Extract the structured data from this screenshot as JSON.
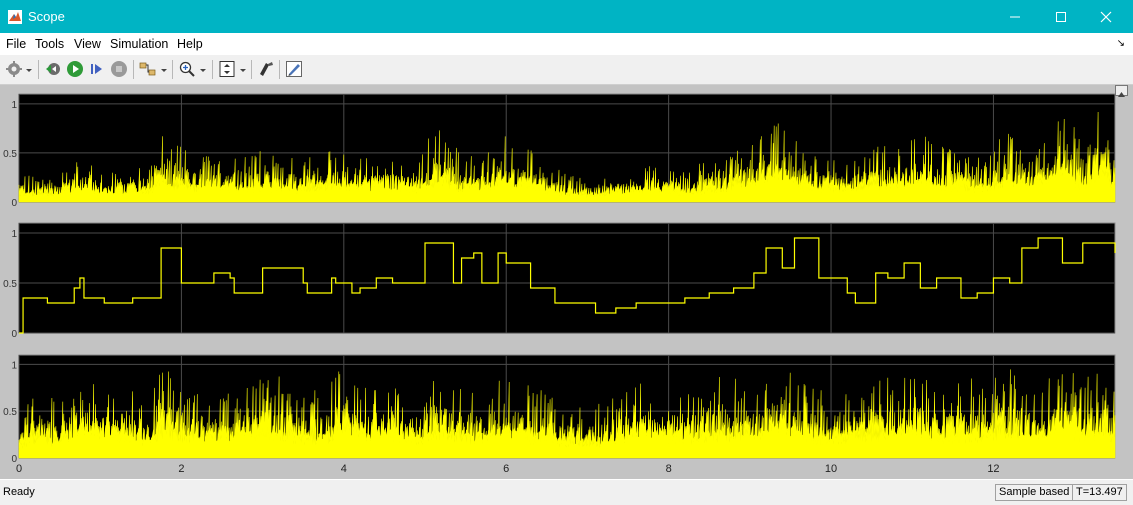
{
  "window": {
    "title": "Scope",
    "minimize_icon": "minimize-icon",
    "maximize_icon": "maximize-icon",
    "close_icon": "close-icon"
  },
  "menu": [
    "File",
    "Tools",
    "View",
    "Simulation",
    "Help"
  ],
  "toolbar": {
    "icons": [
      "settings-gear-icon",
      "dropdown-arrow-icon",
      "step-back-icon",
      "run-icon",
      "step-forward-icon",
      "stop-icon",
      "highlight-simulink-block-icon",
      "dropdown-arrow-icon",
      "zoom-in-icon",
      "dropdown-arrow-icon",
      "scale-axes-icon",
      "dropdown-arrow-icon",
      "style-icon",
      "edit-icon"
    ]
  },
  "colors": {
    "titlebar": "#00b4c4",
    "axes_background": "#000000",
    "trace": "#ffff00",
    "grid": "#4b4b4b",
    "frame": "#c3c3c3"
  },
  "chart_data": [
    {
      "type": "line",
      "xlim": [
        0,
        13.497
      ],
      "ylim": [
        0,
        1.1
      ],
      "yticks": [
        0,
        0.5,
        1
      ],
      "ytick_labels": [
        "0",
        "0.5",
        "1"
      ],
      "xticks": [
        0,
        2,
        4,
        6,
        8,
        10,
        12
      ],
      "grid": true,
      "style": "noisy-fill",
      "envelope_x": [
        0,
        0.2,
        0.5,
        0.8,
        1.0,
        1.3,
        1.6,
        1.75,
        1.9,
        2.2,
        2.6,
        3.0,
        3.2,
        3.5,
        3.8,
        4.0,
        4.3,
        4.6,
        4.9,
        5.15,
        5.4,
        5.7,
        5.95,
        6.1,
        6.4,
        6.7,
        7.0,
        7.3,
        7.6,
        7.9,
        8.2,
        8.5,
        8.8,
        9.1,
        9.35,
        9.6,
        9.9,
        10.2,
        10.5,
        10.8,
        11.1,
        11.4,
        11.7,
        12.0,
        12.2,
        12.45,
        12.6,
        12.9,
        13.1,
        13.3,
        13.497
      ],
      "envelope_y": [
        0.3,
        0.25,
        0.3,
        0.45,
        0.3,
        0.35,
        0.4,
        0.75,
        0.6,
        0.5,
        0.45,
        0.55,
        0.5,
        0.45,
        0.6,
        0.5,
        0.45,
        0.5,
        0.45,
        0.8,
        0.55,
        0.45,
        0.7,
        0.6,
        0.5,
        0.3,
        0.25,
        0.3,
        0.35,
        0.4,
        0.3,
        0.45,
        0.55,
        0.65,
        0.9,
        0.6,
        0.45,
        0.5,
        0.55,
        0.6,
        0.7,
        0.55,
        0.5,
        0.55,
        0.8,
        0.55,
        0.6,
        0.95,
        0.6,
        0.95,
        0.7
      ]
    },
    {
      "type": "line",
      "xlim": [
        0,
        13.497
      ],
      "ylim": [
        0,
        1.1
      ],
      "yticks": [
        0,
        0.5,
        1
      ],
      "ytick_labels": [
        "0",
        "0.5",
        "1"
      ],
      "xticks": [
        0,
        2,
        4,
        6,
        8,
        10,
        12
      ],
      "grid": true,
      "style": "step",
      "x": [
        0,
        0.05,
        0.3,
        0.35,
        0.65,
        0.68,
        0.75,
        0.8,
        1.0,
        1.05,
        1.35,
        1.4,
        1.7,
        1.75,
        1.95,
        2.0,
        2.3,
        2.4,
        2.6,
        2.65,
        2.95,
        3.0,
        3.2,
        3.5,
        3.55,
        3.85,
        3.9,
        4.1,
        4.2,
        4.4,
        4.6,
        4.75,
        5.0,
        5.05,
        5.35,
        5.45,
        5.6,
        5.7,
        5.9,
        6.0,
        6.2,
        6.3,
        6.5,
        6.6,
        6.8,
        7.1,
        7.35,
        7.6,
        7.9,
        8.2,
        8.5,
        8.8,
        9.05,
        9.2,
        9.4,
        9.55,
        9.75,
        9.85,
        10.0,
        10.2,
        10.3,
        10.55,
        10.7,
        10.9,
        11.1,
        11.3,
        11.6,
        11.8,
        12.0,
        12.2,
        12.35,
        12.55,
        12.7,
        12.85,
        13.1,
        13.3,
        13.497
      ],
      "y": [
        0,
        0.35,
        0.35,
        0.3,
        0.3,
        0.45,
        0.55,
        0.35,
        0.35,
        0.3,
        0.3,
        0.35,
        0.35,
        0.85,
        0.85,
        0.5,
        0.5,
        0.6,
        0.55,
        0.4,
        0.4,
        0.65,
        0.65,
        0.5,
        0.4,
        0.55,
        0.5,
        0.4,
        0.45,
        0.55,
        0.5,
        0.5,
        0.9,
        0.9,
        0.5,
        0.75,
        0.8,
        0.5,
        0.8,
        0.7,
        0.7,
        0.45,
        0.45,
        0.3,
        0.3,
        0.2,
        0.25,
        0.3,
        0.3,
        0.35,
        0.4,
        0.45,
        0.6,
        0.85,
        0.65,
        0.95,
        0.95,
        0.55,
        0.55,
        0.4,
        0.3,
        0.6,
        0.55,
        0.7,
        0.45,
        0.55,
        0.35,
        0.4,
        0.55,
        0.5,
        0.85,
        0.95,
        0.95,
        0.7,
        0.9,
        0.9,
        0.8
      ]
    },
    {
      "type": "line",
      "xlim": [
        0,
        13.497
      ],
      "ylim": [
        0,
        1.1
      ],
      "yticks": [
        0,
        0.5,
        1
      ],
      "ytick_labels": [
        "0",
        "0.5",
        "1"
      ],
      "xticks": [
        0,
        2,
        4,
        6,
        8,
        10,
        12
      ],
      "xtick_labels": [
        "0",
        "2",
        "4",
        "6",
        "8",
        "10",
        "12"
      ],
      "grid": true,
      "style": "noisy-fill",
      "envelope_x": [
        0,
        0.2,
        0.5,
        0.8,
        1.0,
        1.3,
        1.6,
        1.75,
        1.9,
        2.2,
        2.6,
        3.0,
        3.2,
        3.5,
        3.8,
        4.0,
        4.3,
        4.6,
        4.9,
        5.15,
        5.4,
        5.7,
        5.95,
        6.1,
        6.4,
        6.7,
        7.0,
        7.3,
        7.6,
        7.9,
        8.2,
        8.5,
        8.8,
        9.1,
        9.35,
        9.6,
        9.9,
        10.2,
        10.5,
        10.8,
        11.1,
        11.4,
        11.7,
        12.0,
        12.2,
        12.45,
        12.6,
        12.9,
        13.1,
        13.3,
        13.497
      ],
      "envelope_y": [
        0.4,
        0.8,
        0.6,
        0.95,
        0.7,
        0.8,
        0.65,
        1.0,
        0.9,
        0.75,
        0.7,
        0.85,
        0.9,
        0.7,
        0.8,
        1.0,
        0.75,
        0.85,
        0.7,
        1.0,
        0.8,
        0.75,
        0.9,
        0.85,
        0.75,
        0.6,
        0.55,
        0.65,
        0.85,
        0.8,
        0.75,
        0.85,
        0.9,
        0.8,
        1.0,
        0.85,
        0.75,
        0.8,
        0.9,
        0.85,
        0.9,
        0.8,
        0.85,
        0.85,
        1.0,
        0.8,
        0.85,
        1.0,
        0.85,
        1.0,
        0.8
      ]
    }
  ],
  "status": {
    "ready": "Ready",
    "mode": "Sample based",
    "time": "T=13.497"
  }
}
